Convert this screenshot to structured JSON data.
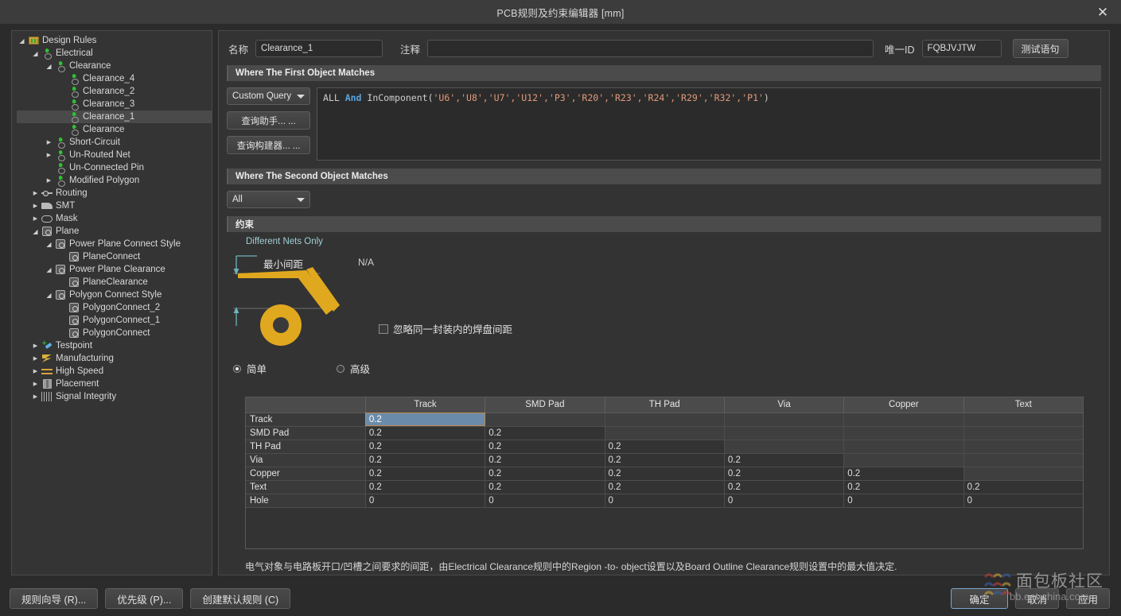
{
  "window": {
    "title": "PCB规则及约束编辑器 [mm]",
    "close_label": "✕"
  },
  "tree": {
    "items": [
      {
        "label": "Design Rules",
        "depth": 0,
        "arrow": "down",
        "icon": "folder-icon",
        "selected": false
      },
      {
        "label": "Electrical",
        "depth": 1,
        "arrow": "down",
        "icon": "electrical-icon",
        "selected": false
      },
      {
        "label": "Clearance",
        "depth": 2,
        "arrow": "down",
        "icon": "electrical-icon",
        "selected": false
      },
      {
        "label": "Clearance_4",
        "depth": 3,
        "arrow": "none",
        "icon": "electrical-icon",
        "selected": false
      },
      {
        "label": "Clearance_2",
        "depth": 3,
        "arrow": "none",
        "icon": "electrical-icon",
        "selected": false
      },
      {
        "label": "Clearance_3",
        "depth": 3,
        "arrow": "none",
        "icon": "electrical-icon",
        "selected": false
      },
      {
        "label": "Clearance_1",
        "depth": 3,
        "arrow": "none",
        "icon": "electrical-icon",
        "selected": true
      },
      {
        "label": "Clearance",
        "depth": 3,
        "arrow": "none",
        "icon": "electrical-icon",
        "selected": false
      },
      {
        "label": "Short-Circuit",
        "depth": 2,
        "arrow": "right",
        "icon": "electrical-icon",
        "selected": false
      },
      {
        "label": "Un-Routed Net",
        "depth": 2,
        "arrow": "right",
        "icon": "electrical-icon",
        "selected": false
      },
      {
        "label": "Un-Connected Pin",
        "depth": 2,
        "arrow": "none",
        "icon": "electrical-icon",
        "selected": false
      },
      {
        "label": "Modified Polygon",
        "depth": 2,
        "arrow": "right",
        "icon": "electrical-icon",
        "selected": false
      },
      {
        "label": "Routing",
        "depth": 1,
        "arrow": "right",
        "icon": "routing-icon",
        "selected": false
      },
      {
        "label": "SMT",
        "depth": 1,
        "arrow": "right",
        "icon": "smt-icon",
        "selected": false
      },
      {
        "label": "Mask",
        "depth": 1,
        "arrow": "right",
        "icon": "mask-icon",
        "selected": false
      },
      {
        "label": "Plane",
        "depth": 1,
        "arrow": "down",
        "icon": "plane-icon",
        "selected": false
      },
      {
        "label": "Power Plane Connect Style",
        "depth": 2,
        "arrow": "down",
        "icon": "plane-icon",
        "selected": false
      },
      {
        "label": "PlaneConnect",
        "depth": 3,
        "arrow": "none",
        "icon": "plane-icon",
        "selected": false
      },
      {
        "label": "Power Plane Clearance",
        "depth": 2,
        "arrow": "down",
        "icon": "plane-icon",
        "selected": false
      },
      {
        "label": "PlaneClearance",
        "depth": 3,
        "arrow": "none",
        "icon": "plane-icon",
        "selected": false
      },
      {
        "label": "Polygon Connect Style",
        "depth": 2,
        "arrow": "down",
        "icon": "plane-icon",
        "selected": false
      },
      {
        "label": "PolygonConnect_2",
        "depth": 3,
        "arrow": "none",
        "icon": "plane-icon",
        "selected": false
      },
      {
        "label": "PolygonConnect_1",
        "depth": 3,
        "arrow": "none",
        "icon": "plane-icon",
        "selected": false
      },
      {
        "label": "PolygonConnect",
        "depth": 3,
        "arrow": "none",
        "icon": "plane-icon",
        "selected": false
      },
      {
        "label": "Testpoint",
        "depth": 1,
        "arrow": "right",
        "icon": "testpoint-icon",
        "selected": false
      },
      {
        "label": "Manufacturing",
        "depth": 1,
        "arrow": "right",
        "icon": "manufacturing-icon",
        "selected": false
      },
      {
        "label": "High Speed",
        "depth": 1,
        "arrow": "right",
        "icon": "high-speed-icon",
        "selected": false
      },
      {
        "label": "Placement",
        "depth": 1,
        "arrow": "right",
        "icon": "placement-icon",
        "selected": false
      },
      {
        "label": "Signal Integrity",
        "depth": 1,
        "arrow": "right",
        "icon": "signal-integrity-icon",
        "selected": false
      }
    ]
  },
  "form": {
    "name_label": "名称",
    "name_value": "Clearance_1",
    "comment_label": "注释",
    "comment_value": "",
    "comment_placeholder": "",
    "uid_label": "唯一ID",
    "uid_value": "FQBJVJTW",
    "test_query_button": "测试语句"
  },
  "first_object": {
    "band_title": "Where The First Object Matches",
    "scope_value": "Custom Query",
    "query_helper_button": "查询助手... ...",
    "query_builder_button": "查询构建器... ...",
    "query": {
      "prefix": "ALL ",
      "keyword": "And",
      "func": " InComponent(",
      "args": "'U6','U8','U7','U12','P3','R20','R23','R24','R29','R32','P1'",
      "suffix": ")"
    }
  },
  "second_object": {
    "band_title": "Where The Second Object Matches",
    "scope_value": "All"
  },
  "constraints": {
    "band_title": "约束",
    "different_nets_only": "Different Nets Only",
    "minimum_clearance_label": "最小间距",
    "na_value": "N/A",
    "ignore_pad_checkbox_label": "忽略同一封装内的焊盘间距",
    "ignore_pad_checked": false,
    "mode_simple": "简单",
    "mode_advanced": "高级",
    "mode_selected": "简单",
    "accent_gold": "#e0a81e",
    "accent_teal": "#6fb3ba"
  },
  "matrix": {
    "columns": [
      "",
      "Track",
      "SMD Pad",
      "TH Pad",
      "Via",
      "Copper",
      "Text"
    ],
    "rows": [
      {
        "label": "Track",
        "values": [
          "0.2",
          "",
          "",
          "",
          "",
          ""
        ]
      },
      {
        "label": "SMD Pad",
        "values": [
          "0.2",
          "0.2",
          "",
          "",
          "",
          ""
        ]
      },
      {
        "label": "TH Pad",
        "values": [
          "0.2",
          "0.2",
          "0.2",
          "",
          "",
          ""
        ]
      },
      {
        "label": "Via",
        "values": [
          "0.2",
          "0.2",
          "0.2",
          "0.2",
          "",
          ""
        ]
      },
      {
        "label": "Copper",
        "values": [
          "0.2",
          "0.2",
          "0.2",
          "0.2",
          "0.2",
          ""
        ]
      },
      {
        "label": "Text",
        "values": [
          "0.2",
          "0.2",
          "0.2",
          "0.2",
          "0.2",
          "0.2"
        ]
      },
      {
        "label": "Hole",
        "values": [
          "0",
          "0",
          "0",
          "0",
          "0",
          "0"
        ]
      }
    ],
    "selected_cell": {
      "row": 0,
      "col": 0
    },
    "selected_fill": "#6b8bab",
    "selected_border": "#c08a4e"
  },
  "description": "电气对象与电路板开口/凹槽之间要求的间距，由Electrical Clearance规则中的Region -to- object设置以及Board Outline Clearance规则设置中的最大值决定.",
  "footer": {
    "rule_wizard": "规则向导 (R)...",
    "priority": "优先级 (P)...",
    "create_default_rules": "创建默认规则 (C)",
    "ok": "确定",
    "cancel": "取消",
    "apply": "应用"
  },
  "watermark": {
    "text": "面包板社区",
    "url": "bb.eet-china.com"
  }
}
